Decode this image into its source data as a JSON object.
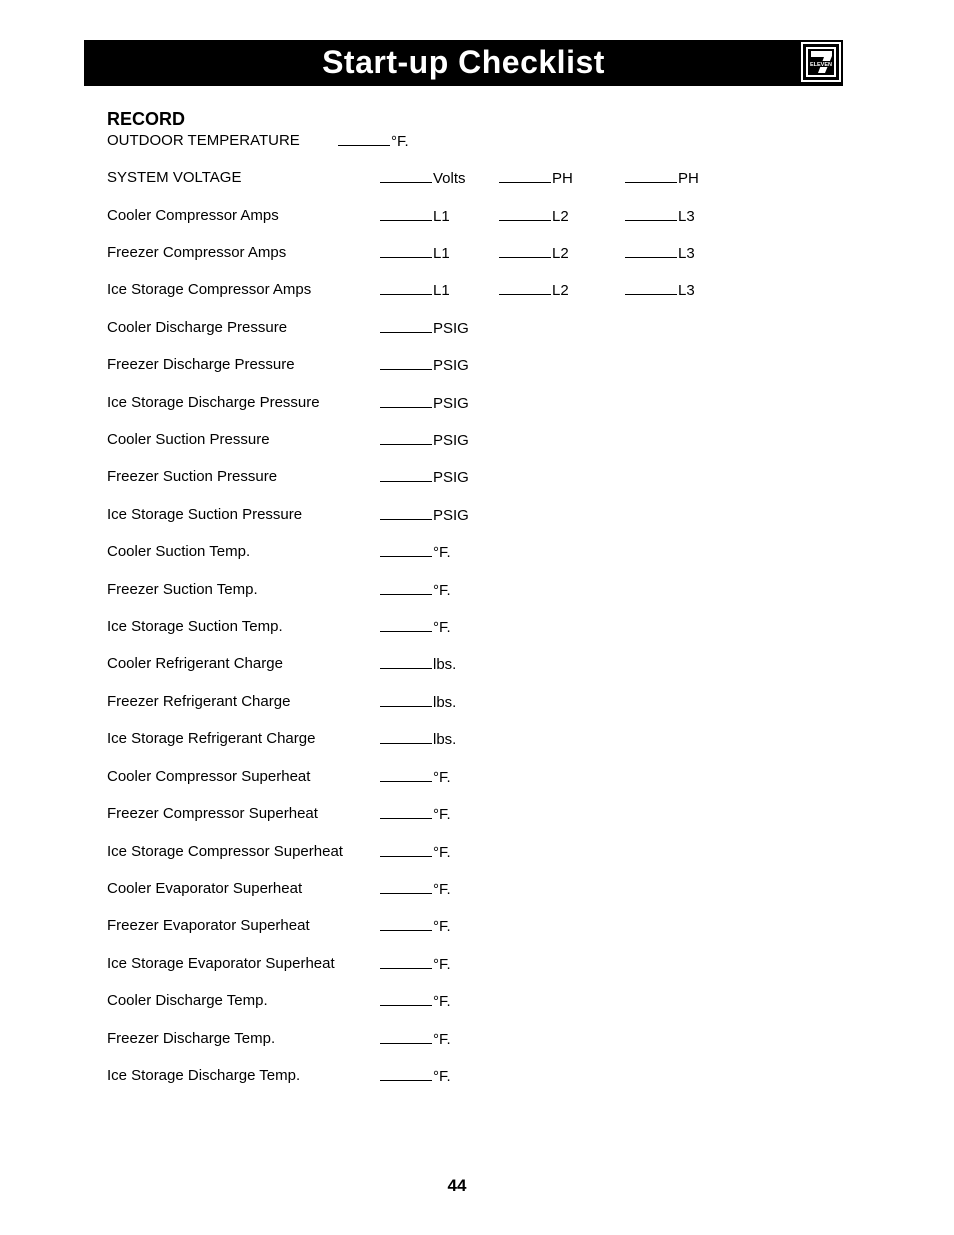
{
  "header": {
    "title": "Start-up Checklist",
    "logo": "7-eleven-logo",
    "logo_text": "ELEVEN"
  },
  "section_title": "RECORD",
  "rows": [
    {
      "label": "OUTDOOR TEMPERATURE",
      "fields": [
        "°F."
      ]
    },
    {
      "label": "SYSTEM VOLTAGE",
      "fields": [
        "Volts",
        "PH",
        "PH"
      ]
    },
    {
      "label": "Cooler Compressor Amps",
      "fields": [
        "L1",
        "L2",
        "L3"
      ]
    },
    {
      "label": "Freezer Compressor Amps",
      "fields": [
        "L1",
        "L2",
        "L3"
      ]
    },
    {
      "label": "Ice Storage Compressor Amps",
      "fields": [
        "L1",
        "L2",
        "L3"
      ]
    },
    {
      "label": "Cooler Discharge Pressure",
      "fields": [
        "PSIG"
      ]
    },
    {
      "label": "Freezer Discharge Pressure",
      "fields": [
        "PSIG"
      ]
    },
    {
      "label": "Ice Storage Discharge Pressure",
      "fields": [
        "PSIG"
      ]
    },
    {
      "label": "Cooler Suction Pressure",
      "fields": [
        "PSIG"
      ]
    },
    {
      "label": "Freezer Suction Pressure",
      "fields": [
        "PSIG"
      ]
    },
    {
      "label": "Ice Storage Suction Pressure",
      "fields": [
        "PSIG"
      ]
    },
    {
      "label": "Cooler Suction Temp.",
      "fields": [
        "°F."
      ]
    },
    {
      "label": "Freezer Suction Temp.",
      "fields": [
        "°F."
      ]
    },
    {
      "label": "Ice Storage Suction Temp.",
      "fields": [
        "°F."
      ]
    },
    {
      "label": "Cooler Refrigerant Charge",
      "fields": [
        "lbs."
      ]
    },
    {
      "label": "Freezer Refrigerant Charge",
      "fields": [
        "lbs."
      ]
    },
    {
      "label": "Ice Storage Refrigerant Charge",
      "fields": [
        "lbs."
      ]
    },
    {
      "label": "Cooler Compressor Superheat",
      "fields": [
        "°F."
      ]
    },
    {
      "label": "Freezer Compressor Superheat",
      "fields": [
        "°F."
      ]
    },
    {
      "label": "Ice Storage Compressor Superheat",
      "fields": [
        "°F."
      ]
    },
    {
      "label": "Cooler Evaporator Superheat",
      "fields": [
        "°F."
      ]
    },
    {
      "label": "Freezer Evaporator Superheat",
      "fields": [
        "°F."
      ]
    },
    {
      "label": "Ice Storage Evaporator Superheat",
      "fields": [
        "°F."
      ]
    },
    {
      "label": "Cooler Discharge Temp.",
      "fields": [
        "°F."
      ]
    },
    {
      "label": "Freezer Discharge Temp.",
      "fields": [
        "°F."
      ]
    },
    {
      "label": "Ice Storage Discharge Temp.",
      "fields": [
        "°F."
      ]
    }
  ],
  "page_number": "44"
}
